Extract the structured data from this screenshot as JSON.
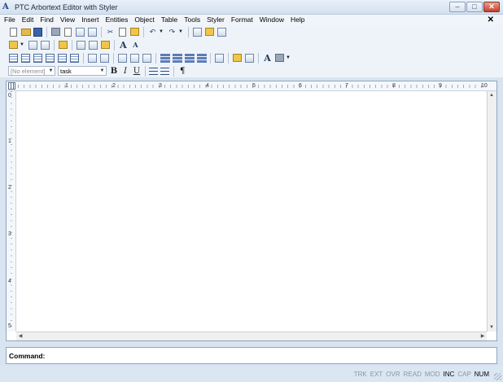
{
  "window": {
    "title": "PTC Arbortext Editor with Styler",
    "app_icon_glyph": "A",
    "controls": {
      "minimize": "–",
      "maximize": "□",
      "close": "✕"
    }
  },
  "menubar": {
    "items": [
      "File",
      "Edit",
      "Find",
      "View",
      "Insert",
      "Entities",
      "Object",
      "Table",
      "Tools",
      "Styler",
      "Format",
      "Window",
      "Help"
    ],
    "close_glyph": "✕"
  },
  "toolbar": {
    "element_combo": {
      "value": "[No element]",
      "arrow": "▼"
    },
    "style_combo": {
      "value": "task",
      "arrow": "▼"
    },
    "format": {
      "bold": "B",
      "italic": "I",
      "underline": "U"
    },
    "pilcrow": "¶",
    "font_larger": "A",
    "font_smaller": "A",
    "dropdown_arrow": "▼"
  },
  "ruler": {
    "horizontal_numbers": [
      "1",
      "2",
      "3",
      "4",
      "5",
      "6",
      "7",
      "8",
      "9",
      "10"
    ],
    "vertical_numbers": [
      "0",
      "1",
      "2",
      "3",
      "4",
      "5"
    ]
  },
  "command": {
    "label": "Command:",
    "value": ""
  },
  "status": {
    "indicators": [
      {
        "label": "TRK",
        "active": false
      },
      {
        "label": "EXT",
        "active": false
      },
      {
        "label": "OVR",
        "active": false
      },
      {
        "label": "READ",
        "active": false
      },
      {
        "label": "MOD",
        "active": false
      },
      {
        "label": "INC",
        "active": true
      },
      {
        "label": "CAP",
        "active": false
      },
      {
        "label": "NUM",
        "active": true
      }
    ]
  },
  "colors": {
    "chrome": "#d9e4f1",
    "toolbar": "#eef3f9",
    "close_button": "#c4402a"
  },
  "icons": [
    "new-document-icon",
    "open-folder-icon",
    "save-icon",
    "print-icon",
    "print-preview-icon",
    "find-icon",
    "spellcheck-icon",
    "cut-icon",
    "copy-icon",
    "paste-icon",
    "undo-icon",
    "redo-icon",
    "tags-icon",
    "insert-markup-icon",
    "split-icon",
    "join-icon",
    "font-larger-icon",
    "font-smaller-icon",
    "table-icon",
    "align-icon",
    "highlight-icon"
  ]
}
